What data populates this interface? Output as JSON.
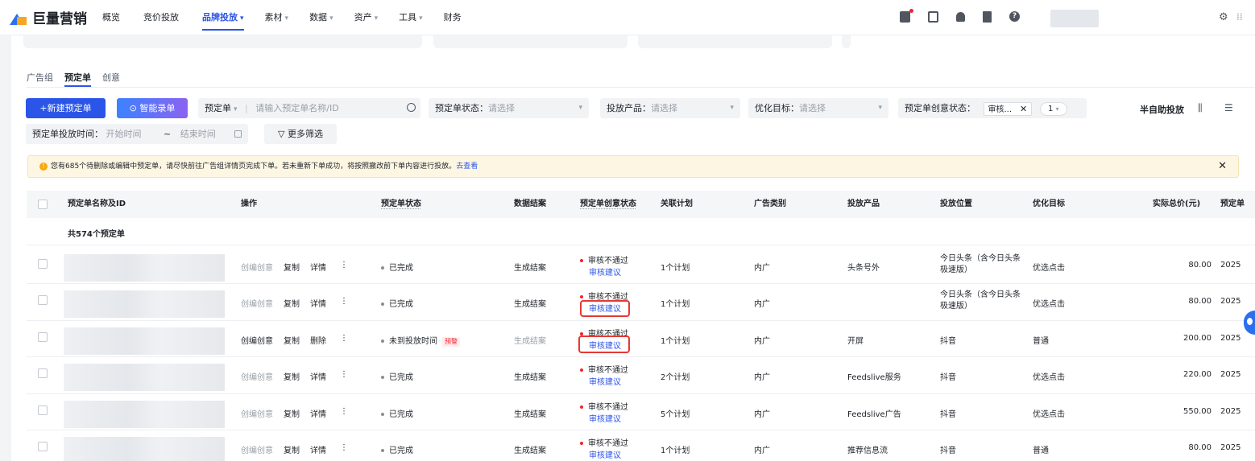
{
  "brand": {
    "name": "巨量营销"
  },
  "nav": [
    {
      "label": "概览",
      "active": false,
      "caret": ""
    },
    {
      "label": "竞价投放",
      "active": false,
      "caret": ""
    },
    {
      "label": "品牌投放",
      "active": true,
      "caret": "▾"
    },
    {
      "label": "素材",
      "active": false,
      "caret": "▾"
    },
    {
      "label": "数据",
      "active": false,
      "caret": "▾"
    },
    {
      "label": "资产",
      "active": false,
      "caret": "▾"
    },
    {
      "label": "工具",
      "active": false,
      "caret": "▾"
    },
    {
      "label": "财务",
      "active": false,
      "caret": ""
    }
  ],
  "top_icons": [
    "gift-icon",
    "clipboard-icon",
    "bell-icon",
    "book-icon",
    "help-icon"
  ],
  "help_glyph": "?",
  "settings_glyph": "⚙",
  "apps_glyph": "⁞⁞",
  "tabs": [
    {
      "label": "广告组",
      "active": false
    },
    {
      "label": "预定单",
      "active": true
    },
    {
      "label": "创意",
      "active": false
    }
  ],
  "toolbar": {
    "new_order": "+新建预定单",
    "smart_entry": "⊙ 智能录单",
    "order_type_label": "预定单",
    "order_search_placeholder": "请输入预定单名称/ID",
    "status_label": "预定单状态：",
    "status_placeholder": "请选择",
    "product_label": "投放产品：",
    "product_placeholder": "请选择",
    "goal_label": "优化目标：",
    "goal_placeholder": "请选择",
    "creative_status_label": "预定单创意状态：",
    "creative_status_tag": "审核...",
    "tag_close": "✕",
    "creative_status_count": "1",
    "semi_auto": "半自助投放",
    "date_label": "预定单投放时间：",
    "date_start": "开始时间",
    "date_sep": "~",
    "date_end": "结束时间",
    "more_filter": "▽ 更多筛选"
  },
  "notice": {
    "icon_glyph": "!",
    "text": "您有685个待删除或编辑中预定单，请尽快前往广告组详情页完成下单。若未重新下单成功，将按照撤改前下单内容进行投放。",
    "link": "去查看",
    "close": "✕"
  },
  "table": {
    "headers": {
      "name": "预定单名称及ID",
      "action": "操作",
      "status": "预定单状态",
      "settle": "数据结案",
      "creative_status": "预定单创意状态",
      "plan": "关联计划",
      "ad_type": "广告类别",
      "product": "投放产品",
      "position": "投放位置",
      "goal": "优化目标",
      "price": "实际总价(元)",
      "date": "预定单"
    },
    "total": "共574个预定单",
    "rows": [
      {
        "act1": "创编创意",
        "act1_grey": true,
        "act2": "复制",
        "act3": "详情",
        "more": "⋮",
        "status": "已完成",
        "alert": "",
        "settle": "生成结案",
        "settle_grey": false,
        "creative_status": "审核不通过",
        "creative_link": "审核建议",
        "plan": "1个计划",
        "ad_type": "内广",
        "product": "头条号外",
        "position": "今日头条（含今日头条极速版）",
        "goal": "优选点击",
        "price": "80.00",
        "date": "2025"
      },
      {
        "act1": "创编创意",
        "act1_grey": true,
        "act2": "复制",
        "act3": "详情",
        "more": "⋮",
        "status": "已完成",
        "alert": "",
        "settle": "生成结案",
        "settle_grey": false,
        "creative_status": "审核不通过",
        "creative_link": "审核建议",
        "plan": "1个计划",
        "ad_type": "内广",
        "product": "",
        "position": "今日头条（含今日头条极速版）",
        "goal": "优选点击",
        "price": "80.00",
        "date": "2025"
      },
      {
        "act1": "创编创意",
        "act1_grey": false,
        "act2": "复制",
        "act3": "删除",
        "more": "⋮",
        "status": "未到投放时间",
        "alert": "预警",
        "settle": "生成结案",
        "settle_grey": true,
        "creative_status": "审核不通过",
        "creative_link": "审核建议",
        "plan": "1个计划",
        "ad_type": "内广",
        "product": "开屏",
        "position": "抖音",
        "goal": "普通",
        "price": "200.00",
        "date": "2025"
      },
      {
        "act1": "创编创意",
        "act1_grey": true,
        "act2": "复制",
        "act3": "详情",
        "more": "⋮",
        "status": "已完成",
        "alert": "",
        "settle": "生成结案",
        "settle_grey": false,
        "creative_status": "审核不通过",
        "creative_link": "审核建议",
        "plan": "2个计划",
        "ad_type": "内广",
        "product": "Feedslive服务",
        "position": "抖音",
        "goal": "优选点击",
        "price": "220.00",
        "date": "2025"
      },
      {
        "act1": "创编创意",
        "act1_grey": true,
        "act2": "复制",
        "act3": "详情",
        "more": "⋮",
        "status": "已完成",
        "alert": "",
        "settle": "生成结案",
        "settle_grey": false,
        "creative_status": "审核不通过",
        "creative_link": "审核建议",
        "plan": "5个计划",
        "ad_type": "内广",
        "product": "Feedslive广告",
        "position": "抖音",
        "goal": "优选点击",
        "price": "550.00",
        "date": "2025"
      },
      {
        "act1": "创编创意",
        "act1_grey": true,
        "act2": "复制",
        "act3": "详情",
        "more": "⋮",
        "status": "已完成",
        "alert": "",
        "settle": "生成结案",
        "settle_grey": false,
        "creative_status": "审核不通过",
        "creative_link": "审核建议",
        "plan": "1个计划",
        "ad_type": "内广",
        "product": "推荐信息流",
        "position": "抖音",
        "goal": "普通",
        "price": "80.00",
        "date": "2025"
      }
    ]
  },
  "colors": {
    "accent": "#2b55e8",
    "danger": "#e53935",
    "notice_bg": "#fdf6e3"
  }
}
